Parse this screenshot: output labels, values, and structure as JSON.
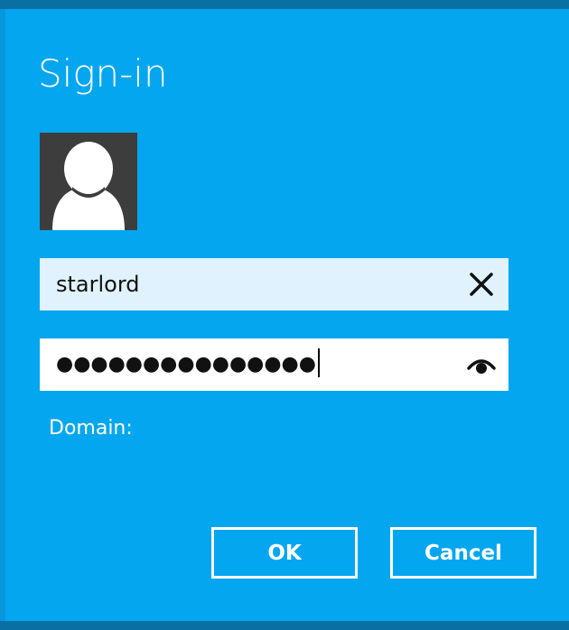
{
  "dialog": {
    "title": "Sign-in"
  },
  "username": {
    "value": "starlord",
    "clear_icon": "close-icon"
  },
  "password": {
    "masked_value": "●●●●●●●●●●●●●●●",
    "reveal_icon": "eye-icon"
  },
  "domain": {
    "label": "Domain:"
  },
  "buttons": {
    "ok_label": "OK",
    "cancel_label": "Cancel"
  },
  "colors": {
    "background": "#05a6f0",
    "frame": "#0a6fa3",
    "username_field": "#dff2fd",
    "password_field": "#ffffff",
    "avatar_bg": "#3d3d3d"
  }
}
